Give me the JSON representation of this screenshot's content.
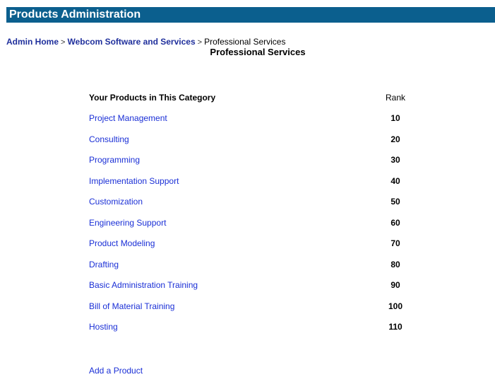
{
  "header": {
    "title": "Products Administration"
  },
  "breadcrumb": {
    "items": [
      "Admin Home",
      "Webcom Software and Services"
    ],
    "separator": ">",
    "current": "Professional Services"
  },
  "page_title": "Professional Services",
  "table": {
    "headers": {
      "name": "Your Products in This Category",
      "rank": "Rank"
    },
    "rows": [
      {
        "name": "Project Management",
        "rank": "10"
      },
      {
        "name": "Consulting",
        "rank": "20"
      },
      {
        "name": "Programming",
        "rank": "30"
      },
      {
        "name": "Implementation Support",
        "rank": "40"
      },
      {
        "name": "Customization",
        "rank": "50"
      },
      {
        "name": "Engineering Support",
        "rank": "60"
      },
      {
        "name": "Product Modeling",
        "rank": "70"
      },
      {
        "name": "Drafting",
        "rank": "80"
      },
      {
        "name": "Basic Administration Training",
        "rank": "90"
      },
      {
        "name": "Bill of Material Training",
        "rank": "100"
      },
      {
        "name": "Hosting",
        "rank": "110"
      }
    ]
  },
  "actions": {
    "add_product": "Add a Product"
  },
  "colors": {
    "header_bg": "#0b5f8e",
    "link": "#1a2fd6",
    "breadcrumb_link": "#1f2f9c"
  }
}
